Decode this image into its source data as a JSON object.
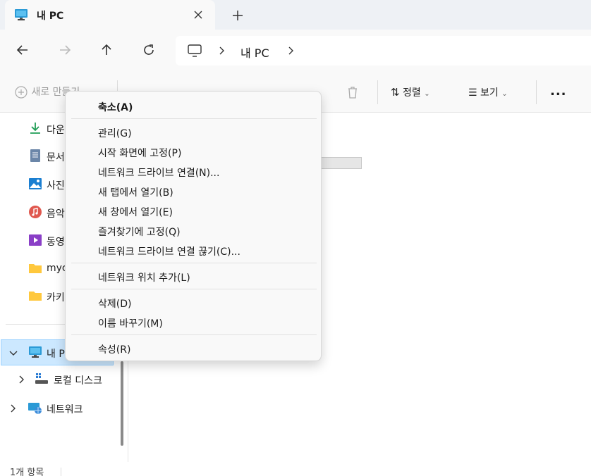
{
  "tab": {
    "title": "내 PC"
  },
  "address": {
    "segment": "내 PC"
  },
  "commands": {
    "new_label": "새로 만들기",
    "sort_label": "정렬",
    "view_label": "보기",
    "more_label": "..."
  },
  "sidebar": {
    "items": [
      {
        "label": "다운",
        "icon": "download-icon"
      },
      {
        "label": "문서",
        "icon": "document-icon"
      },
      {
        "label": "사진",
        "icon": "pictures-icon"
      },
      {
        "label": "음악",
        "icon": "music-icon"
      },
      {
        "label": "동영",
        "icon": "video-icon"
      },
      {
        "label": "myc",
        "icon": "folder-icon"
      },
      {
        "label": "카키",
        "icon": "folder-icon"
      }
    ],
    "this_pc": "내 P",
    "local_disk": "로컬 디스크",
    "network": "네트워크"
  },
  "context_menu": {
    "items": [
      "축소(A)",
      "관리(G)",
      "시작 화면에 고정(P)",
      "네트워크 드라이브 연결(N)...",
      "새 탭에서 열기(B)",
      "새 창에서 열기(E)",
      "즐겨찾기에 고정(Q)",
      "네트워크 드라이브 연결 끊기(C)...",
      "네트워크 위치 추가(L)",
      "삭제(D)",
      "이름 바꾸기(M)",
      "속성(R)"
    ]
  },
  "status": {
    "count": "1개 항목"
  },
  "colors": {
    "accent": "#0078d4",
    "selection": "#cce8ff",
    "folder": "#ffc83d"
  }
}
